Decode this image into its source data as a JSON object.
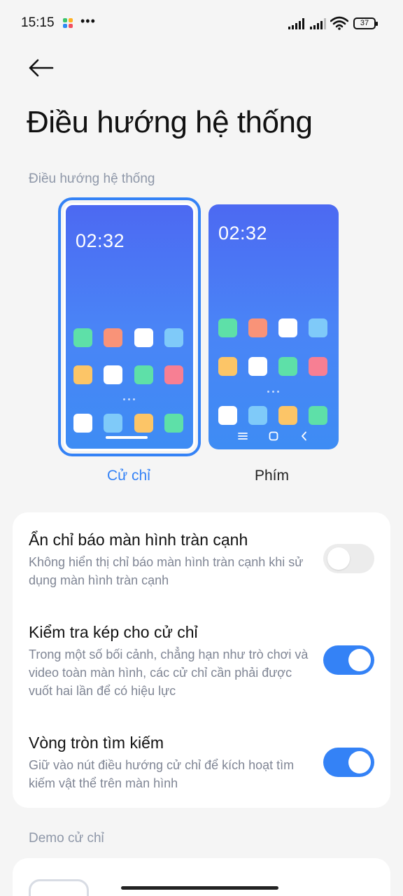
{
  "status_bar": {
    "time": "15:15",
    "more": "•••",
    "battery": "37"
  },
  "header": {
    "back_icon": "arrow-left-icon",
    "title": "Điều hướng hệ thống"
  },
  "nav_section": {
    "label": "Điều hướng hệ thống",
    "options": [
      {
        "label": "Cử chỉ",
        "clock": "02:32",
        "selected": true
      },
      {
        "label": "Phím",
        "clock": "02:32",
        "selected": false
      }
    ]
  },
  "settings": [
    {
      "title": "Ẩn chỉ báo màn hình tràn cạnh",
      "description": "Không hiển thị chỉ báo màn hình tràn cạnh khi sử dụng màn hình tràn cạnh",
      "enabled": false
    },
    {
      "title": "Kiểm tra kép cho cử chỉ",
      "description": "Trong một số bối cảnh, chẳng hạn như trò chơi và video toàn màn hình, các cử chỉ cần phải được vuốt hai lần để có hiệu lực",
      "enabled": true
    },
    {
      "title": "Vòng tròn tìm kiếm",
      "description": "Giữ vào nút điều hướng cử chỉ để kích hoạt tìm kiếm vật thể trên màn hình",
      "enabled": true
    }
  ],
  "demo_section": {
    "label": "Demo cử chỉ"
  },
  "colors": {
    "accent": "#3482f6",
    "background": "#f5f5f5",
    "card": "#ffffff",
    "secondary_text": "#7f8594",
    "tile_green": "#5ee0a8",
    "tile_orange": "#f99378",
    "tile_yellow": "#fcc567",
    "tile_sky": "#7fcaf9",
    "tile_pink": "#f77f93",
    "tile_white": "#ffffff"
  }
}
